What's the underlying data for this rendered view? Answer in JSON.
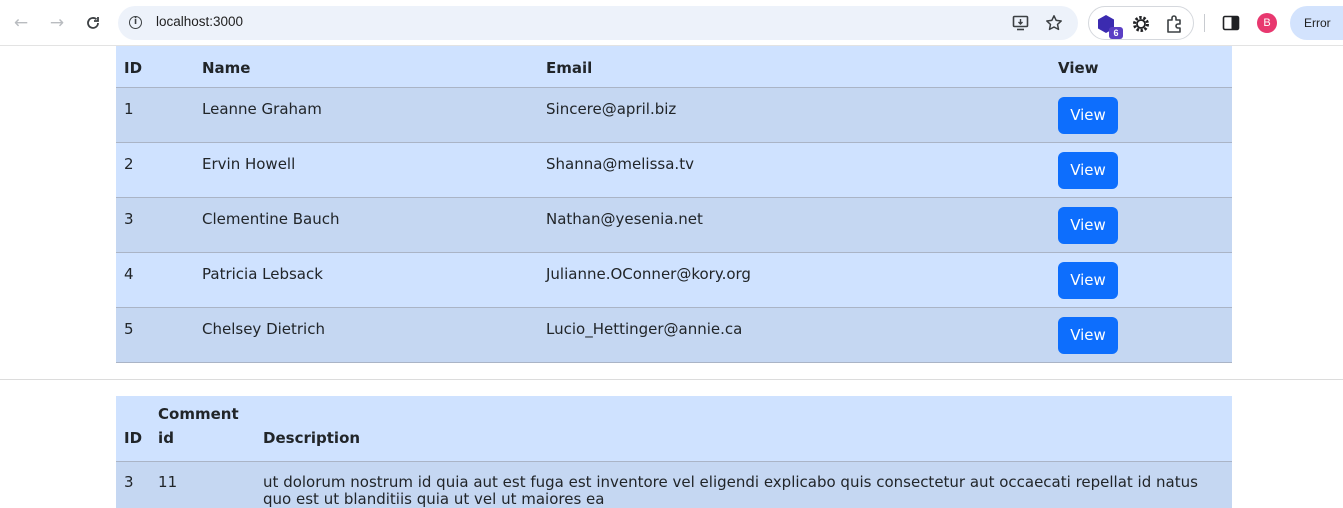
{
  "browser": {
    "url": "localhost:3000",
    "extension_badge": "6",
    "profile_initial": "B",
    "error_label": "Error"
  },
  "users_table": {
    "headers": [
      "ID",
      "Name",
      "Email",
      "View"
    ],
    "rows": [
      {
        "id": "1",
        "name": "Leanne Graham",
        "email": "Sincere@april.biz",
        "button": "View"
      },
      {
        "id": "2",
        "name": "Ervin Howell",
        "email": "Shanna@melissa.tv",
        "button": "View"
      },
      {
        "id": "3",
        "name": "Clementine Bauch",
        "email": "Nathan@yesenia.net",
        "button": "View"
      },
      {
        "id": "4",
        "name": "Patricia Lebsack",
        "email": "Julianne.OConner@kory.org",
        "button": "View"
      },
      {
        "id": "5",
        "name": "Chelsey Dietrich",
        "email": "Lucio_Hettinger@annie.ca",
        "button": "View"
      }
    ]
  },
  "comments_table": {
    "headers": [
      "ID",
      "Comment id",
      "Description"
    ],
    "rows": [
      {
        "id": "3",
        "comment_id": "11",
        "description": "ut dolorum nostrum id quia aut est fuga est inventore vel eligendi explicabo quis consectetur aut occaecati repellat id natus quo est ut blanditiis quia ut vel ut maiores ea"
      }
    ]
  },
  "colors": {
    "header_bg": "#cfe2ff",
    "row_odd_bg": "#c5d7f2",
    "button_bg": "#0d6efd"
  }
}
